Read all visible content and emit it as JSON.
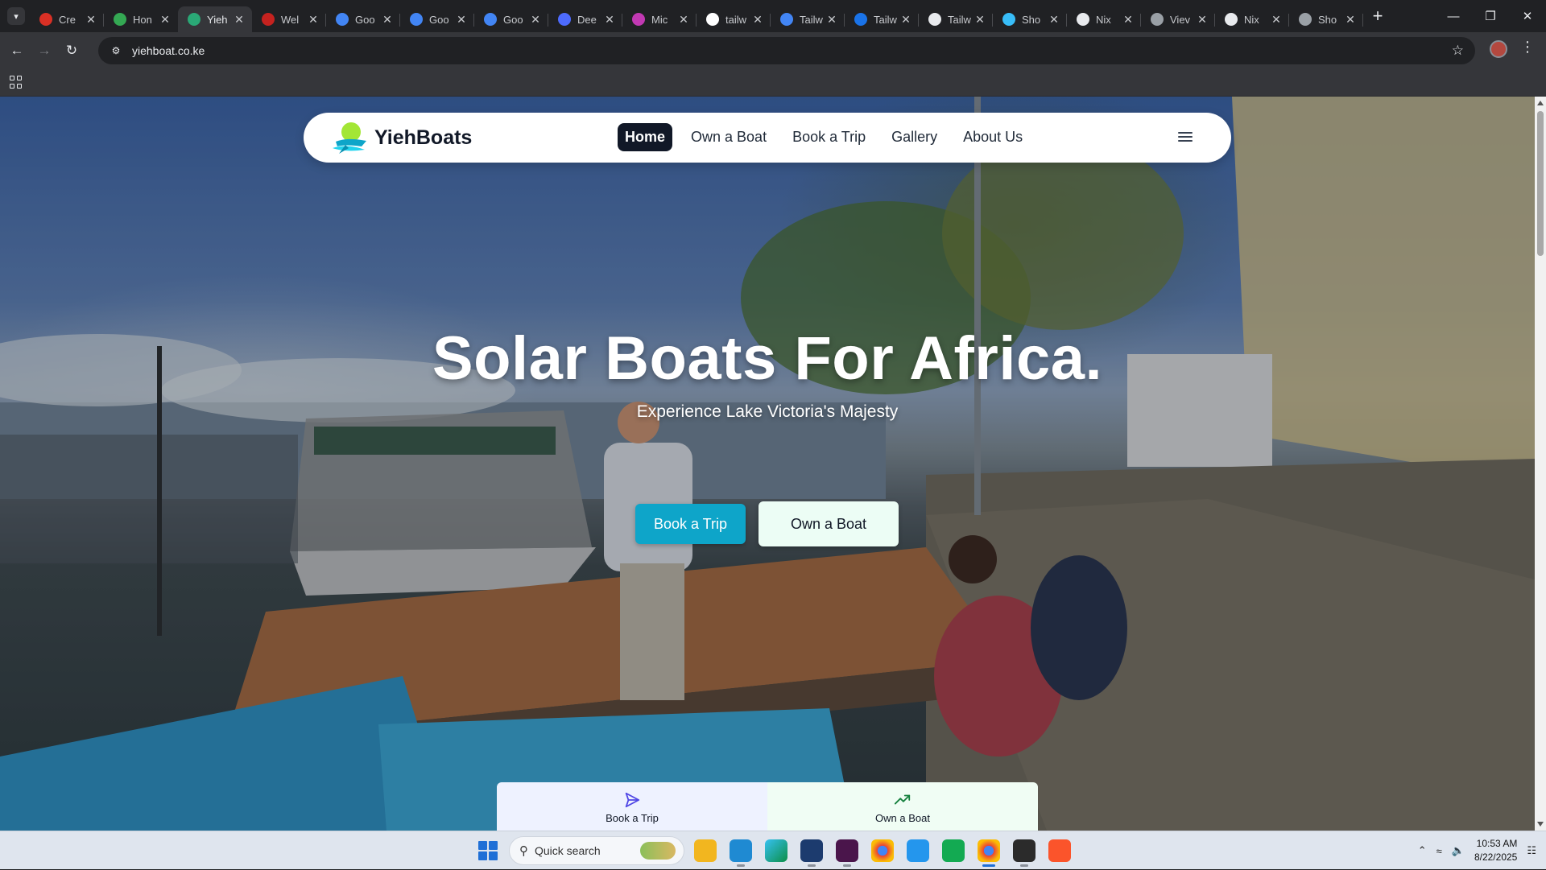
{
  "browser": {
    "tabs": [
      {
        "title": "Cre",
        "favicon_color": "#d93025",
        "favicon_icon": "pinterest-icon"
      },
      {
        "title": "Hon",
        "favicon_color": "#34a853",
        "favicon_icon": "flower-icon"
      },
      {
        "title": "Yieh",
        "favicon_color": "#2aa876",
        "favicon_icon": "boat-icon",
        "active": true
      },
      {
        "title": "Wel",
        "favicon_color": "#c5221f",
        "favicon_icon": "home-icon"
      },
      {
        "title": "Goo",
        "favicon_color": "#4285f4",
        "favicon_icon": "gemini-icon"
      },
      {
        "title": "Goo",
        "favicon_color": "#4285f4",
        "favicon_icon": "gemini-icon"
      },
      {
        "title": "Goo",
        "favicon_color": "#4285f4",
        "favicon_icon": "gemini-icon"
      },
      {
        "title": "Dee",
        "favicon_color": "#4d6bfe",
        "favicon_icon": "deepseek-icon"
      },
      {
        "title": "Mic",
        "favicon_color": "#c239b3",
        "favicon_icon": "copilot-icon"
      },
      {
        "title": "tailw",
        "favicon_color": "#ffffff",
        "favicon_icon": "google-icon"
      },
      {
        "title": "Tailw",
        "favicon_color": "#4285f4",
        "favicon_icon": "google-g-icon"
      },
      {
        "title": "Tailw",
        "favicon_color": "#1a73e8",
        "favicon_icon": "blue-circle-icon"
      },
      {
        "title": "Tailw",
        "favicon_color": "#e8eaed",
        "favicon_icon": "doc-icon"
      },
      {
        "title": "Sho",
        "favicon_color": "#38bdf8",
        "favicon_icon": "tailwind-icon"
      },
      {
        "title": "Nix",
        "favicon_color": "#e8eaed",
        "favicon_icon": "github-icon"
      },
      {
        "title": "Viev",
        "favicon_color": "#9aa0a6",
        "favicon_icon": "globe-icon"
      },
      {
        "title": "Nix",
        "favicon_color": "#e8eaed",
        "favicon_icon": "github-icon"
      },
      {
        "title": "Sho",
        "favicon_color": "#9aa0a6",
        "favicon_icon": "globe-icon"
      }
    ],
    "url": "yiehboat.co.ke"
  },
  "site": {
    "brand": "YiehBoats",
    "nav": [
      "Home",
      "Own a Boat",
      "Book a Trip",
      "Gallery",
      "About Us"
    ],
    "active_nav": "Home",
    "hero_title": "Solar Boats For Africa.",
    "hero_subtitle": "Experience Lake Victoria's Majesty",
    "cta_primary": "Book a Trip",
    "cta_secondary": "Own a Boat",
    "quick_links": [
      {
        "label": "Book a Trip",
        "icon": "paper-plane-icon"
      },
      {
        "label": "Own a Boat",
        "icon": "trending-up-icon"
      }
    ],
    "colors": {
      "primary": "#0ea5c9",
      "secondary_bg": "#ecfdf5",
      "nav_active": "#111827"
    }
  },
  "taskbar": {
    "search_placeholder": "Quick search",
    "apps": [
      "file-explorer-icon",
      "vscode-icon",
      "edge-icon",
      "virtualbox-icon",
      "slack-icon",
      "chrome-icon",
      "docker-icon",
      "mongodb-icon",
      "chrome-profile-icon",
      "terminal-icon",
      "brave-icon"
    ],
    "time": "10:53 AM",
    "date": "8/22/2025"
  }
}
